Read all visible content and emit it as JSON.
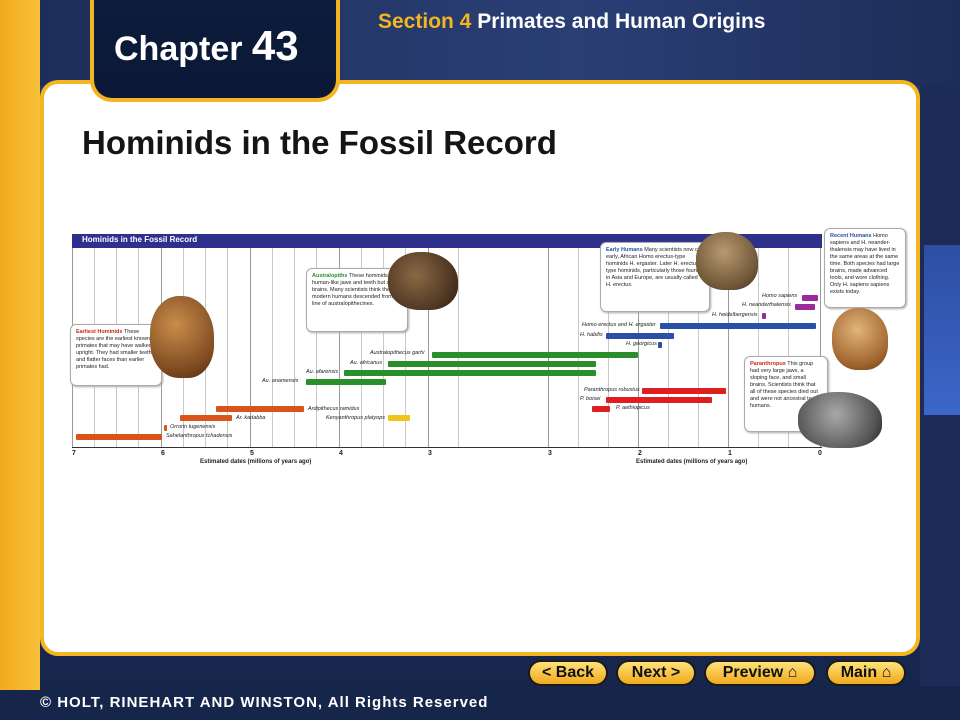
{
  "header": {
    "chapter_word": "Chapter",
    "chapter_number": "43",
    "section_prefix": "Section 4",
    "section_title": "Primates and Human Origins"
  },
  "page_title": "Hominids in the Fossil Record",
  "figure": {
    "title": "Hominids in the Fossil Record",
    "x_axis_label": "Estimated dates (millions of years ago)",
    "ticks_left": [
      "7",
      "6",
      "5",
      "4",
      "3"
    ],
    "ticks_right": [
      "3",
      "2",
      "1",
      "0"
    ],
    "species": [
      {
        "label": "Homo sapiens",
        "color": "#9b2a9b"
      },
      {
        "label": "H. neanderthalensis",
        "color": "#9b2a9b"
      },
      {
        "label": "H. heidelbergensis",
        "color": "#9b2a9b"
      },
      {
        "label": "Homo erectus and H. ergaster",
        "color": "#2a4fa7"
      },
      {
        "label": "H. habilis",
        "color": "#2a4fa7"
      },
      {
        "label": "H. georgicus",
        "color": "#2a4fa7"
      },
      {
        "label": "Australopithecus garhi",
        "color": "#2a8f2a"
      },
      {
        "label": "Au. africanus",
        "color": "#2a8f2a"
      },
      {
        "label": "Au. afarensis",
        "color": "#2a8f2a"
      },
      {
        "label": "Au. anamensis",
        "color": "#2a8f2a"
      },
      {
        "label": "Paranthropus robustus",
        "color": "#dd1f1f"
      },
      {
        "label": "P. boisei",
        "color": "#dd1f1f"
      },
      {
        "label": "P. aethiopicus",
        "color": "#dd1f1f"
      },
      {
        "label": "Ardipithecus ramidus",
        "color": "#d9531a"
      },
      {
        "label": "Ar. kadabba",
        "color": "#d9531a"
      },
      {
        "label": "Kenyanthropus platyops",
        "color": "#f0c419"
      },
      {
        "label": "Orrorin tugenensis",
        "color": "#d9531a"
      },
      {
        "label": "Sahelanthropus tchadensis",
        "color": "#d9531a"
      }
    ],
    "callouts": {
      "earliest": {
        "title": "Earliest Hominids",
        "text": "These species are the earliest known primates that may have walked upright. They had smaller teeth and flatter faces than earlier primates had."
      },
      "australopiths": {
        "title": "Australopiths",
        "text": "These hominids had human-like jaws and teeth but small brains. Many scientists think that modern humans descended from a line of australopithecines."
      },
      "early_humans": {
        "title": "Early Humans",
        "text": "Many scientists now call early, African Homo erectus-type hominids H. ergaster. Later H. erectus-type hominids, particularly those found in Asia and Europe, are usually called H. erectus."
      },
      "recent_humans": {
        "title": "Recent Humans",
        "text": "Homo sapiens and H. neander-thalensis may have lived in the same areas at the same time. Both species had large brains, made advanced tools, and wore clothing. Only H. sapiens sapiens exists today."
      },
      "paranthropus": {
        "title": "Paranthropus",
        "text": "This group had very large jaws, a sloping face, and small brains. Scientists think that all of these species died out and were not ancestral to humans."
      }
    }
  },
  "nav": {
    "back": "< Back",
    "next": "Next >",
    "preview": "Preview",
    "main": "Main"
  },
  "footer": {
    "copyright": "© HOLT, RINEHART AND WINSTON, All Rights Reserved"
  }
}
